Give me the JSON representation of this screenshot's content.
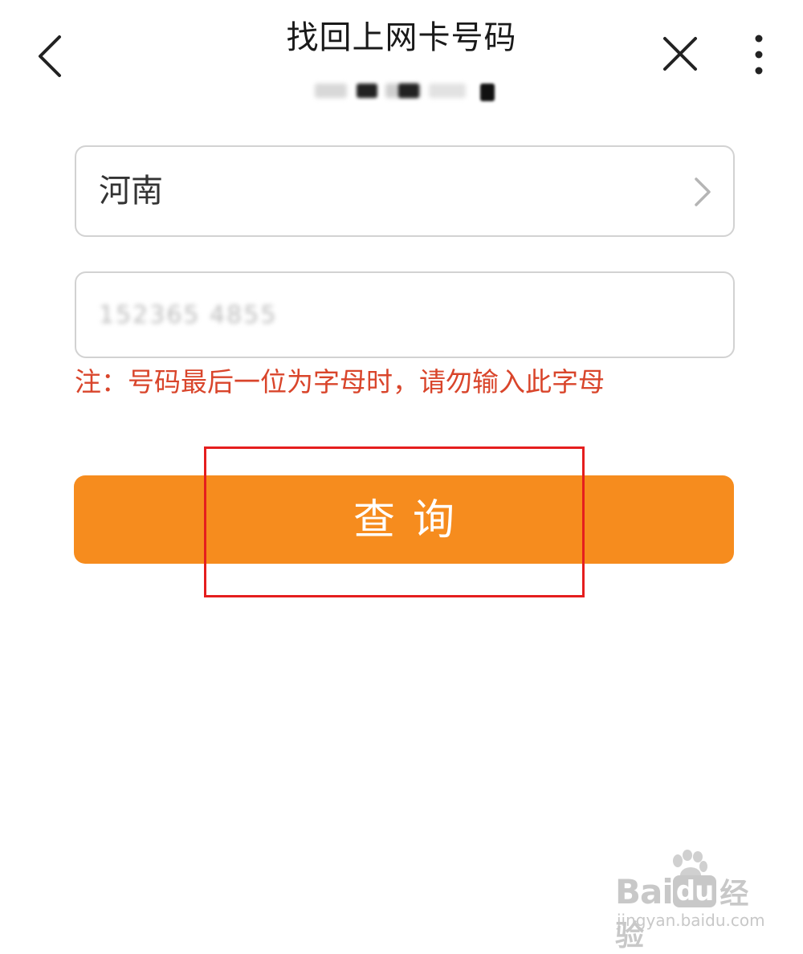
{
  "header": {
    "title": "找回上网卡号码",
    "back_icon": "chevron-left-icon",
    "close_icon": "close-icon",
    "more_icon": "more-vertical-icon"
  },
  "form": {
    "province": {
      "value": "河南",
      "icon": "chevron-right-icon"
    },
    "number": {
      "value": "152365 4855"
    },
    "note": "注：号码最后一位为字母时，请勿输入此字母"
  },
  "query_button": {
    "label": "查询"
  },
  "colors": {
    "accent": "#f68c1e",
    "note_red": "#d9452b",
    "highlight": "#e51e1e"
  },
  "watermark": {
    "logo_bai": "Bai",
    "logo_du": "du",
    "logo_cn": "经验",
    "url": "jingyan.baidu.com"
  }
}
